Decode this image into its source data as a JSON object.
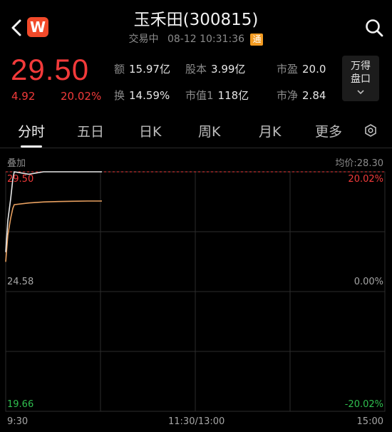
{
  "header": {
    "title": "玉禾田(300815)",
    "status": "交易中",
    "datetime": "08-12 10:31:36",
    "badge": "通",
    "logo_letter": "W"
  },
  "quote": {
    "price": "29.50",
    "change": "4.92",
    "change_pct": "20.02%",
    "metrics": [
      {
        "key": "额",
        "value": "15.97亿"
      },
      {
        "key": "股本",
        "value": "3.99亿"
      },
      {
        "key": "市盈",
        "value": "20.0"
      },
      {
        "key": "换",
        "value": "14.59%"
      },
      {
        "key": "市值1",
        "value": "118亿"
      },
      {
        "key": "市净",
        "value": "2.84"
      }
    ],
    "more_button": {
      "line1": "万得",
      "line2": "盘口"
    }
  },
  "tabs": [
    "分时",
    "五日",
    "日K",
    "周K",
    "月K",
    "更多"
  ],
  "active_tab": "分时",
  "chart": {
    "overlay_label": "叠加",
    "avg_label": "均价:28.30",
    "price_top": "29.50",
    "price_mid": "24.58",
    "price_bottom": "19.66",
    "pct_top": "20.02%",
    "pct_mid": "0.00%",
    "pct_bottom": "-20.02%",
    "time_start": "9:30",
    "time_mid": "11:30/13:00",
    "time_end": "15:00",
    "colors": {
      "up": "#f23a3a",
      "down": "#2fbf4f",
      "price_line": "#e8e8e8",
      "avg_line": "#e8a060",
      "grid": "#2c2c2c"
    }
  },
  "chart_data": {
    "type": "line",
    "ylim": [
      19.66,
      29.5
    ],
    "series": [
      {
        "values": [
          26.2,
          27.5,
          28.4,
          29.2,
          29.5,
          29.4,
          29.5,
          29.5,
          29.5,
          29.5,
          29.5
        ]
      },
      {
        "values": [
          25.8,
          26.9,
          27.6,
          28.0,
          28.15,
          28.22,
          28.26,
          28.28,
          28.29,
          28.3,
          28.3
        ]
      }
    ]
  }
}
